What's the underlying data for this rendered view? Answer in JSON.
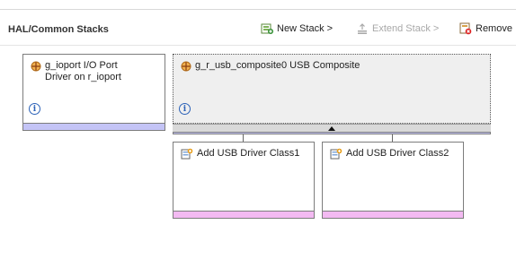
{
  "toolbar": {
    "title": "HAL/Common Stacks",
    "new_stack_label": "New Stack >",
    "extend_stack_label": "Extend Stack >",
    "remove_label": "Remove"
  },
  "stacks": {
    "ioport": {
      "line1": "g_ioport I/O Port",
      "line2": "Driver on r_ioport",
      "info_icon": "info-icon"
    },
    "usb": {
      "label": "g_r_usb_composite0 USB Composite",
      "info_icon": "info-icon"
    },
    "children": [
      {
        "label": "Add USB Driver Class1"
      },
      {
        "label": "Add USB Driver Class2"
      }
    ]
  },
  "colors": {
    "module_bar": "#c4c4f6",
    "add_bar": "#f3baf2",
    "info_blue": "#2c62b8"
  }
}
